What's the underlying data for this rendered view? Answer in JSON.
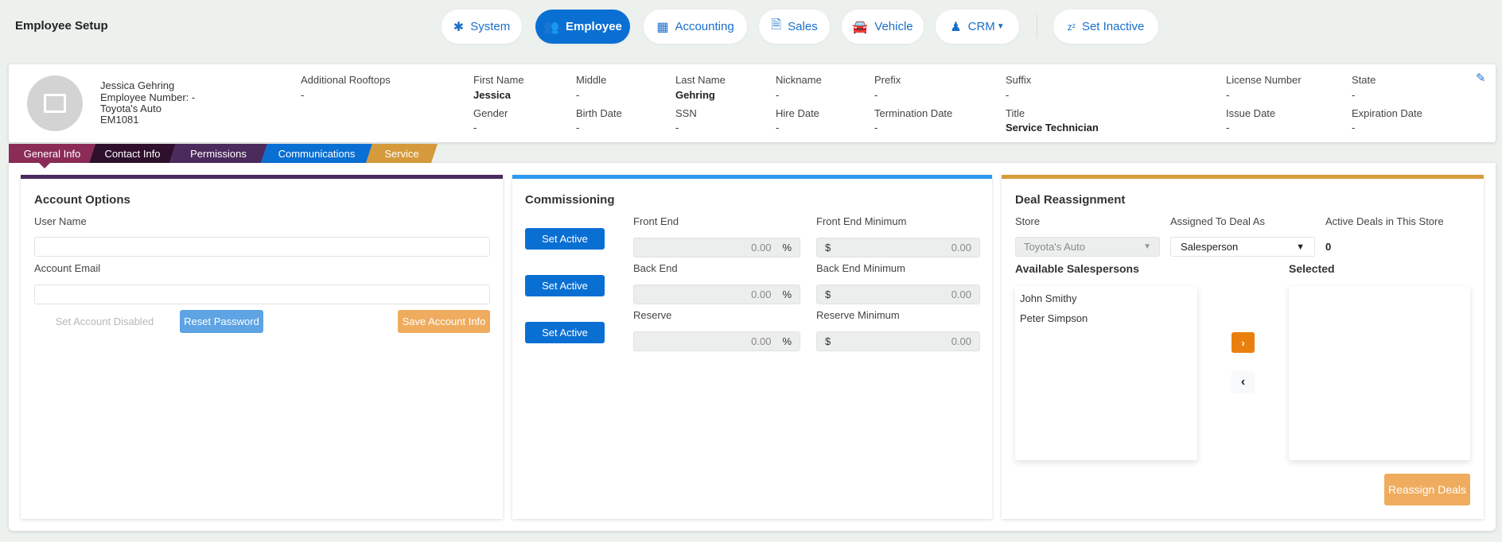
{
  "page_title": "Employee Setup",
  "nav": [
    {
      "label": "System",
      "icon": "asterisk-icon"
    },
    {
      "label": "Employee",
      "icon": "users-icon"
    },
    {
      "label": "Accounting",
      "icon": "calculator-icon"
    },
    {
      "label": "Sales",
      "icon": "sales-doc-icon"
    },
    {
      "label": "Vehicle",
      "icon": "car-icon"
    },
    {
      "label": "CRM",
      "icon": "crm-group-icon"
    },
    {
      "label": "Set Inactive",
      "icon": "sleep-zz-icon"
    }
  ],
  "profile": {
    "name": "Jessica Gehring",
    "employee_number": "Employee Number: -",
    "store": "Toyota's Auto",
    "code": "EM1081",
    "additional_rooftops": {
      "label": "Additional Rooftops",
      "value": "-"
    },
    "fields": [
      {
        "label": "First Name",
        "value": "Jessica"
      },
      {
        "label": "Middle",
        "value": "-"
      },
      {
        "label": "Last Name",
        "value": "Gehring"
      },
      {
        "label": "Nickname",
        "value": "-"
      },
      {
        "label": "Prefix",
        "value": "-"
      },
      {
        "label": "Suffix",
        "value": "-"
      },
      {
        "label": "License Number",
        "value": "-"
      },
      {
        "label": "State",
        "value": "-"
      },
      {
        "label": "Gender",
        "value": "-"
      },
      {
        "label": "Birth Date",
        "value": "-"
      },
      {
        "label": "SSN",
        "value": "-"
      },
      {
        "label": "Hire Date",
        "value": "-"
      },
      {
        "label": "Termination Date",
        "value": "-"
      },
      {
        "label": "Title",
        "value": "Service Technician"
      },
      {
        "label": "Issue Date",
        "value": "-"
      },
      {
        "label": "Expiration Date",
        "value": "-"
      }
    ]
  },
  "tabs": [
    {
      "label": "General Info",
      "color": "#8b2c57"
    },
    {
      "label": "Contact Info",
      "color": "#2e0f2c"
    },
    {
      "label": "Permissions",
      "color": "#4b2a5c"
    },
    {
      "label": "Communications",
      "color": "#0a6fd3"
    },
    {
      "label": "Service",
      "color": "#d59a3b"
    }
  ],
  "account": {
    "heading": "Account Options",
    "user_name_label": "User Name",
    "user_name": "",
    "email_label": "Account Email",
    "email": "",
    "disabled_label": "Set Account Disabled",
    "reset_label": "Reset Password",
    "save_label": "Save Account Info"
  },
  "commissioning": {
    "heading": "Commissioning",
    "set_active": "Set Active",
    "rows": [
      {
        "label": "Front End",
        "value": "0.00",
        "unit": "%",
        "min_label": "Front End Minimum",
        "min_value": "0.00",
        "cur": "$"
      },
      {
        "label": "Back End",
        "value": "0.00",
        "unit": "%",
        "min_label": "Back End Minimum",
        "min_value": "0.00",
        "cur": "$"
      },
      {
        "label": "Reserve",
        "value": "0.00",
        "unit": "%",
        "min_label": "Reserve Minimum",
        "min_value": "0.00",
        "cur": "$"
      }
    ]
  },
  "deals": {
    "heading": "Deal Reassignment",
    "store_label": "Store",
    "store_value": "Toyota's Auto",
    "assigned_label": "Assigned To Deal As",
    "assigned_value": "Salesperson",
    "active_label": "Active Deals in This Store",
    "active_value": "0",
    "available_label": "Available Salespersons",
    "selected_label": "Selected",
    "available": [
      "John Smithy",
      "Peter Simpson"
    ],
    "reassign_label": "Reassign Deals"
  }
}
